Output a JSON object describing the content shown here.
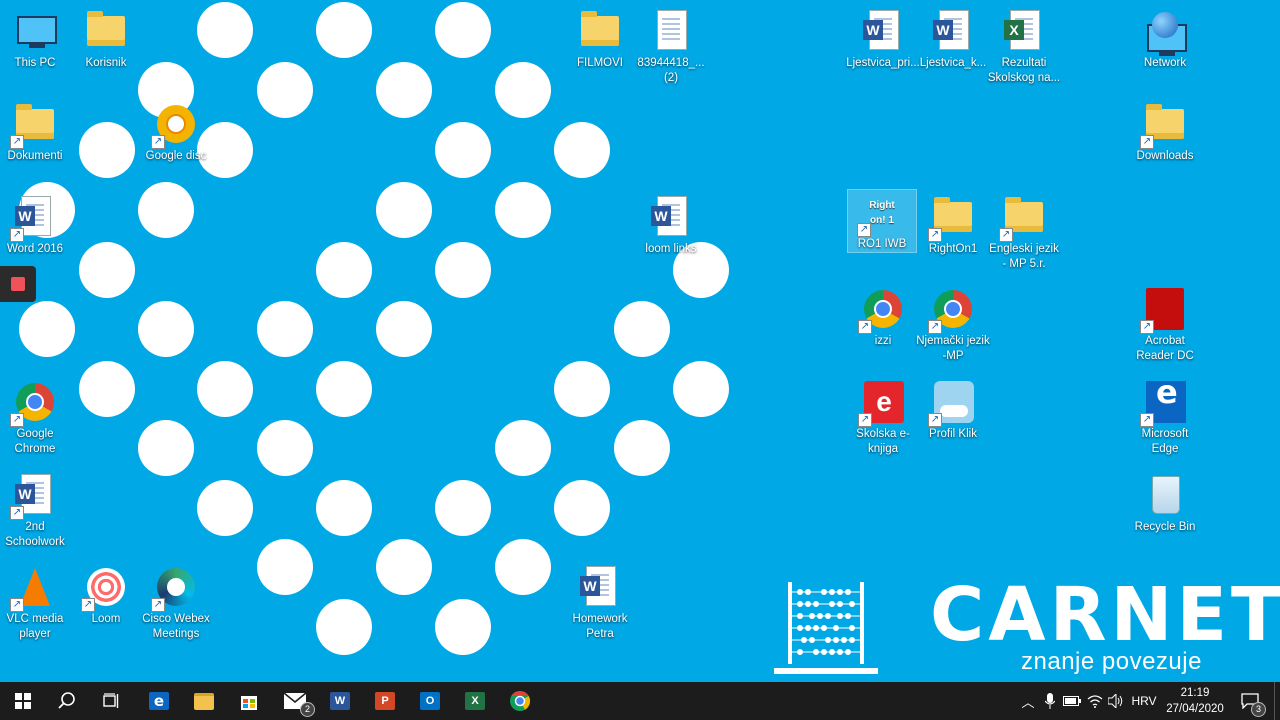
{
  "desktop": {
    "icons": {
      "this_pc": "This PC",
      "korisnik": "Korisnik",
      "dokumenti": "Dokumenti",
      "google_disc": "Google disc",
      "word_2016": "Word 2016",
      "google_chrome": "Google Chrome",
      "schoolwork": "2nd Schoolwork",
      "vlc": "VLC media player",
      "loom": "Loom",
      "webex": "Cisco Webex Meetings",
      "filmovi": "FILMOVI",
      "file_83944418": "83944418_... (2)",
      "loom_links": "loom links",
      "homework_petra": "Homework Petra",
      "ljestvica_pri": "Ljestvica_pri...",
      "ljestvica_k": "Ljestvica_k...",
      "rezultati": "Rezultati Skolskog na...",
      "network": "Network",
      "downloads": "Downloads",
      "ro1_iwb": "RO1 IWB",
      "righton1": "RightOn1",
      "engleski": "Engleski jezik - MP 5.r.",
      "izzi": "izzi",
      "njemacki": "Njemački jezik -MP",
      "acrobat": "Acrobat Reader DC",
      "skolska": "Skolska e-knjiga",
      "profil_klik": "Profil Klik",
      "edge": "Microsoft Edge",
      "recycle_bin": "Recycle Bin"
    },
    "ro1_art_text": "Right on! 1",
    "logo": {
      "name": "CARNET",
      "slogan": "znanje povezuje"
    }
  },
  "taskbar": {
    "word_label": "W",
    "powerpoint_label": "P",
    "outlook_label": "O",
    "excel_label": "X",
    "mail_badge": "2",
    "language": "HRV",
    "time": "21:19",
    "date": "27/04/2020",
    "notification_count": "3"
  },
  "colors": {
    "desktop_background": "#01a8e6",
    "taskbar": "#1c1c1c",
    "dots": "#ffffff"
  },
  "icon_names": {
    "start": "windows-start-icon",
    "search": "search-icon",
    "task_view": "task-view-icon",
    "notifications": "action-center-icon"
  }
}
